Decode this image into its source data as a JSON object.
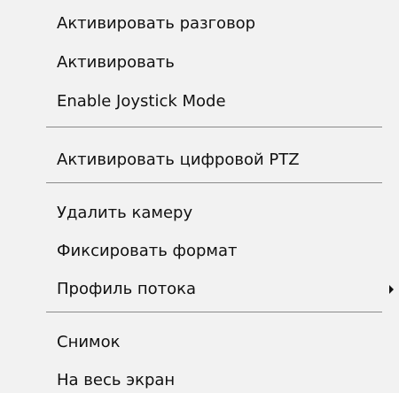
{
  "context_menu": {
    "items": [
      {
        "label": "Активировать разговор"
      },
      {
        "label": "Активировать"
      },
      {
        "label": "Enable Joystick Mode"
      },
      {
        "label": "Активировать цифровой PTZ"
      },
      {
        "label": "Удалить камеру"
      },
      {
        "label": "Фиксировать формат"
      },
      {
        "label": "Профиль потока",
        "has_submenu": true,
        "submenu_icon": "chevron-right-icon"
      },
      {
        "label": "Снимок"
      },
      {
        "label": "На весь экран"
      }
    ],
    "colors": {
      "background": "#f2f2f2",
      "text": "#111111",
      "separator": "#8a8a8a"
    }
  }
}
